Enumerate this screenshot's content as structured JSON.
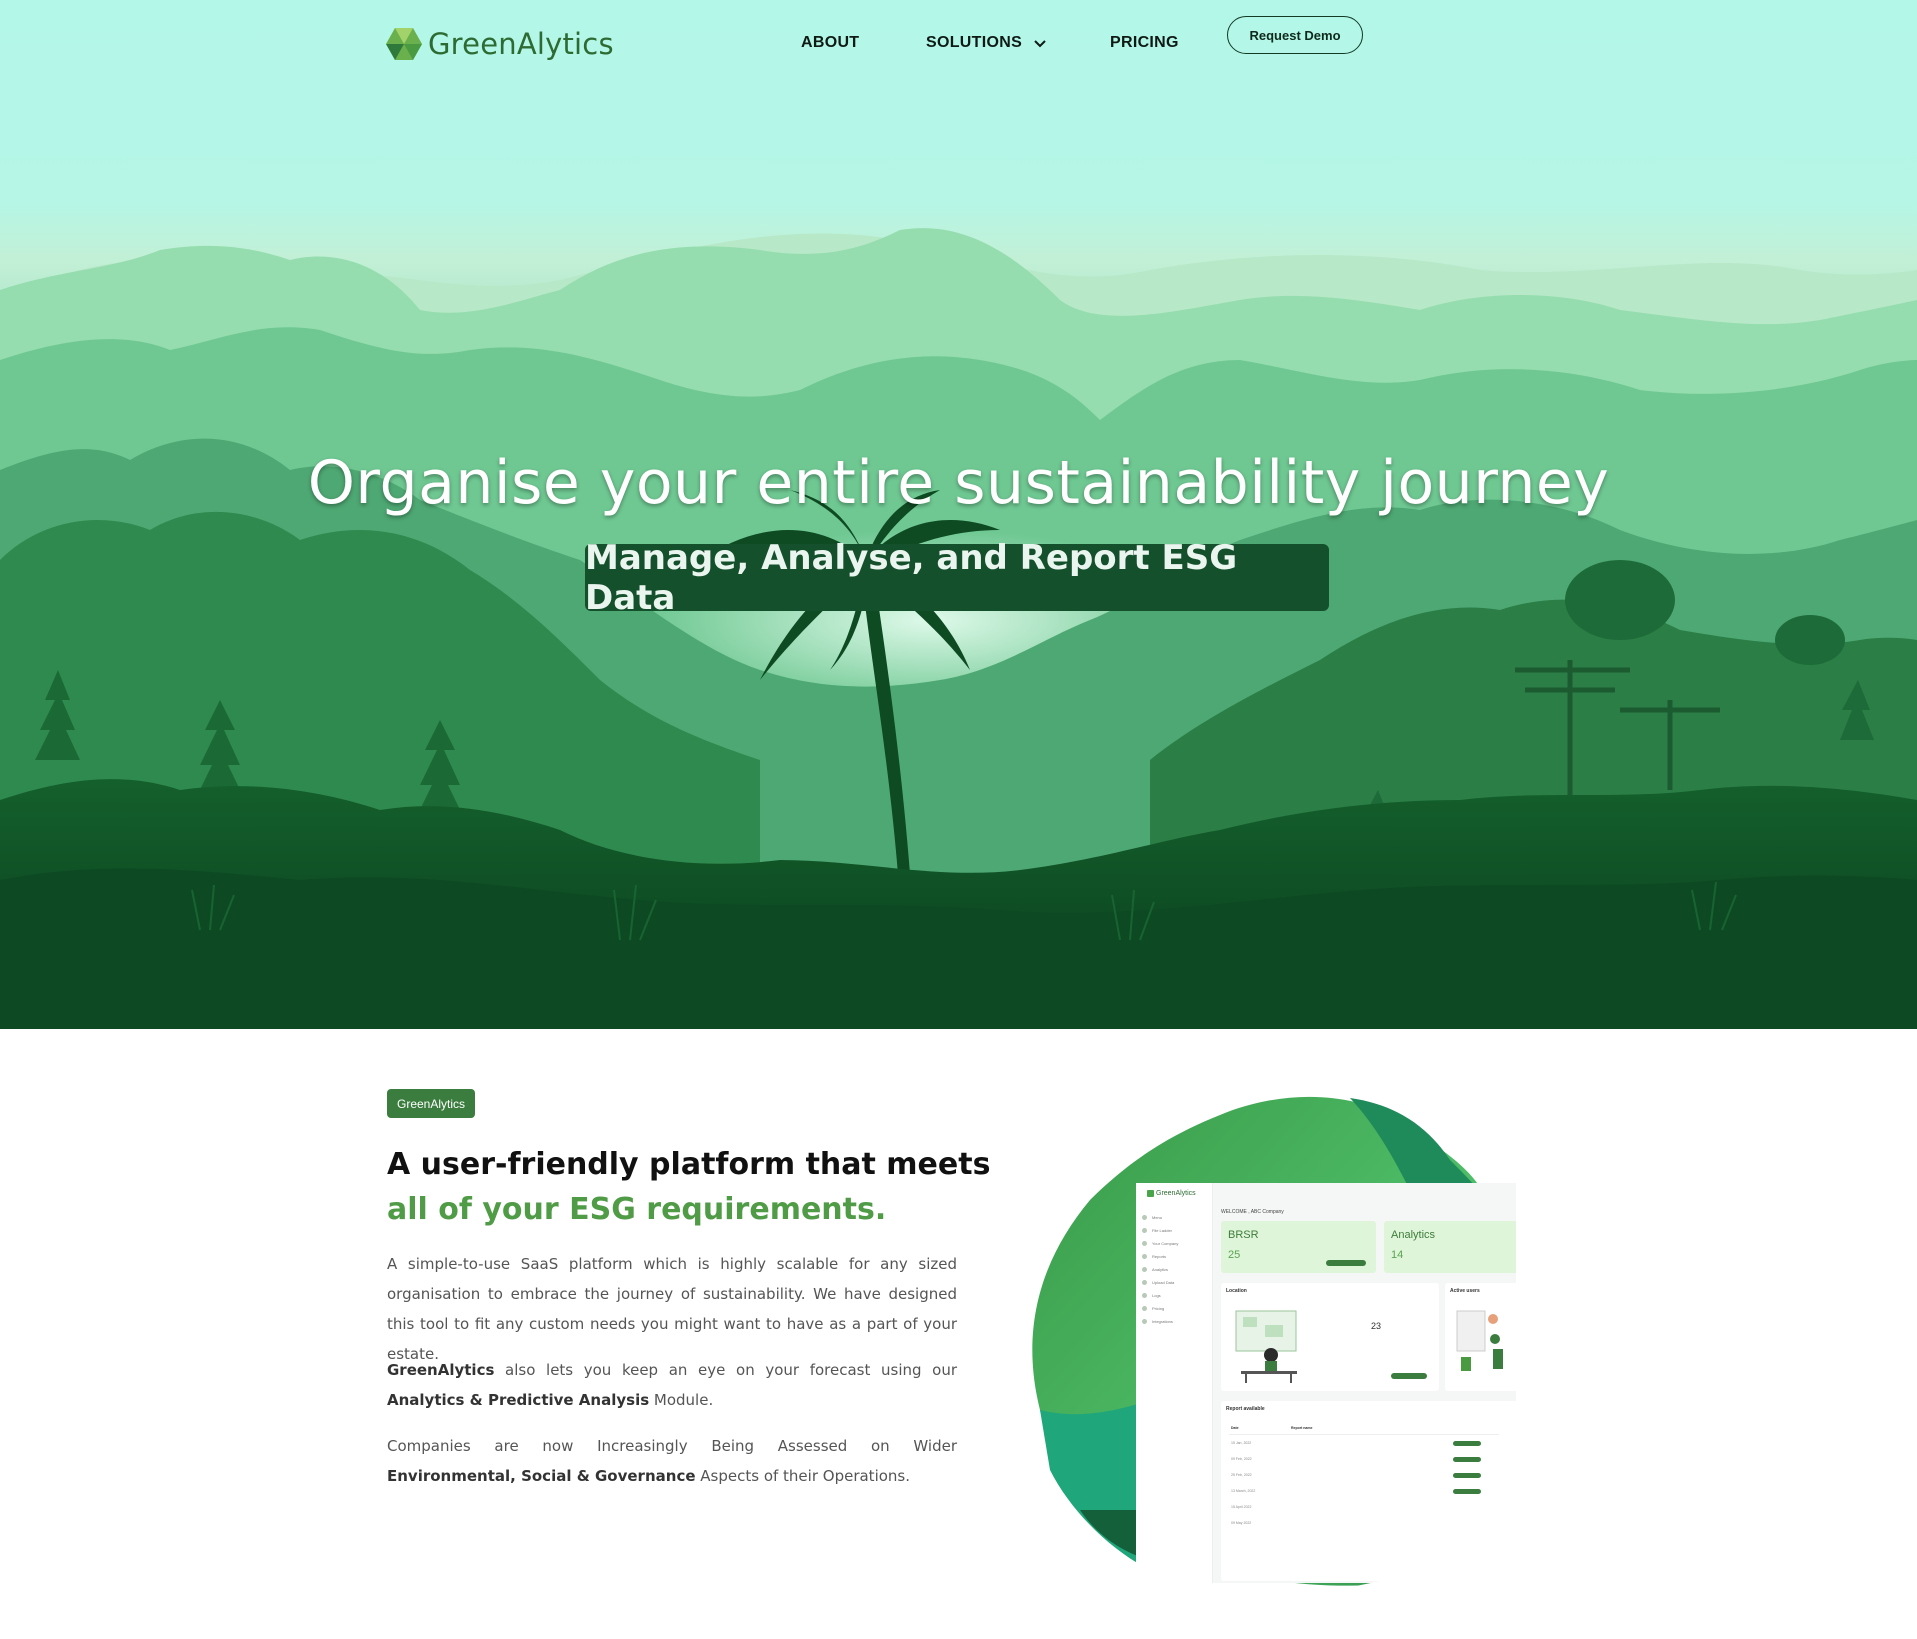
{
  "nav": {
    "logo_text": "GreenAlytics",
    "about": "ABOUT",
    "solutions": "SOLUTIONS",
    "pricing": "PRICING",
    "request_demo": "Request Demo"
  },
  "hero": {
    "headline": "Organise your entire sustainability journey",
    "subheadline": "Manage, Analyse, and Report ESG Data"
  },
  "intro": {
    "badge": "GreenAlytics",
    "heading_line1": "A user-friendly platform that meets",
    "heading_line2": "all of your ESG requirements.",
    "p1": "A simple-to-use SaaS platform which is highly scalable for any sized organisation to embrace the journey of sustainability. We have designed this tool to fit any custom needs you might want to have as a part of your estate.",
    "p2_b1": "GreenAlytics",
    "p2_t1": " also lets you keep an eye on your forecast using our ",
    "p2_b2": "Analytics & Predictive Analysis",
    "p2_t2": " Module.",
    "p3_t1": "Companies are now Increasingly Being Assessed on Wider ",
    "p3_b1": "Environmental, Social & Governance",
    "p3_t2": " Aspects of their Operations."
  },
  "dashboard": {
    "logo": "GreenAlytics",
    "menu": [
      "Menu",
      "File Ladder",
      "Your Company",
      "Reports",
      "Analytics",
      "Upload Data",
      "Logs",
      "Pricing",
      "Integrations"
    ],
    "welcome": "WELCOME , ABC Company",
    "cards": [
      {
        "title": "BRSR",
        "value": "25"
      },
      {
        "title": "Analytics",
        "value": "14"
      }
    ],
    "location_title": "Location",
    "location_count": "23",
    "active_users_title": "Active users",
    "reports_title": "Report available",
    "reports_headers": [
      "Date",
      "Report name"
    ],
    "reports_rows": [
      "15 Jan, 2022",
      "09 Feb, 2022",
      "25 Feb, 2022",
      "13 March, 2022",
      "15 April 2022",
      "09 May 2022"
    ]
  },
  "colors": {
    "brand_green": "#3b7d3f",
    "sky": "#b3f7e9",
    "dark_forest": "#0d4a24",
    "accent_text": "#4f9b46"
  }
}
